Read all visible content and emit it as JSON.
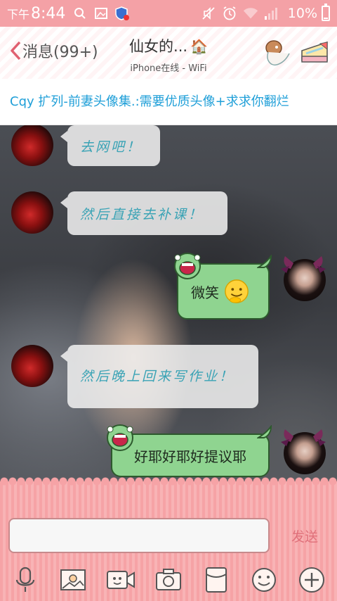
{
  "status_bar": {
    "time_prefix": "下午",
    "time": "8:44",
    "battery": "10%",
    "battery_level": 0.1,
    "icons": [
      "search-icon",
      "image-icon",
      "shield-notification-icon",
      "mute-icon",
      "alarm-icon",
      "wifi-icon",
      "signal-icon",
      "battery-icon"
    ]
  },
  "header": {
    "back_label": "消息(99+)",
    "title": "仙女的...",
    "title_icon": "house-icon",
    "subtitle": "iPhone在线 - WiFi",
    "right_icons": [
      "profile-icon",
      "group-icon"
    ]
  },
  "notice": {
    "text": "Cqy 扩列-前妻头像集.:需要优质头像+求求你翻烂"
  },
  "messages": [
    {
      "side": "in",
      "text": "去网吧！"
    },
    {
      "side": "in",
      "text": "然后直接去补课！"
    },
    {
      "side": "out",
      "text": "微笑",
      "emoji": "smile-emoji"
    },
    {
      "side": "in",
      "text": "然后晚上回来写作业！"
    },
    {
      "side": "out",
      "text": "好耶好耶好提议耶"
    }
  ],
  "input": {
    "value": "",
    "placeholder": "",
    "send_label": "发送"
  },
  "toolbar": {
    "tools": [
      "microphone-icon",
      "photo-album-icon",
      "video-call-icon",
      "camera-icon",
      "red-packet-icon",
      "emoji-icon",
      "plus-icon"
    ]
  },
  "colors": {
    "status_bar": "#f4a1a6",
    "notice_text": "#1f9fd8",
    "incoming_text": "#3aa3b5",
    "outgoing_bubble": "#8fd490",
    "send_text": "#e0707a"
  }
}
